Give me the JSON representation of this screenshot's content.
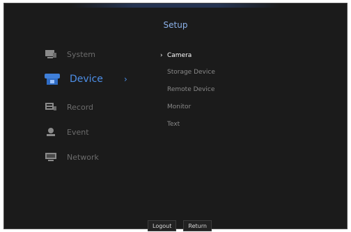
{
  "header": {
    "title": "Setup"
  },
  "menu": {
    "items": [
      {
        "label": "System",
        "icon": "system-icon"
      },
      {
        "label": "Device",
        "icon": "device-icon",
        "active": true
      },
      {
        "label": "Record",
        "icon": "record-icon"
      },
      {
        "label": "Event",
        "icon": "event-icon"
      },
      {
        "label": "Network",
        "icon": "network-icon"
      }
    ],
    "active_chevron": "›"
  },
  "submenu": {
    "items": [
      {
        "label": "Camera",
        "selected": true,
        "marker": "›"
      },
      {
        "label": "Storage Device"
      },
      {
        "label": "Remote Device"
      },
      {
        "label": "Monitor"
      },
      {
        "label": "Text"
      }
    ]
  },
  "footer": {
    "logout_label": "Logout",
    "return_label": "Return"
  },
  "colors": {
    "accent": "#4d8fe8",
    "title": "#8cb2ea",
    "bg": "#1b1b1b"
  }
}
